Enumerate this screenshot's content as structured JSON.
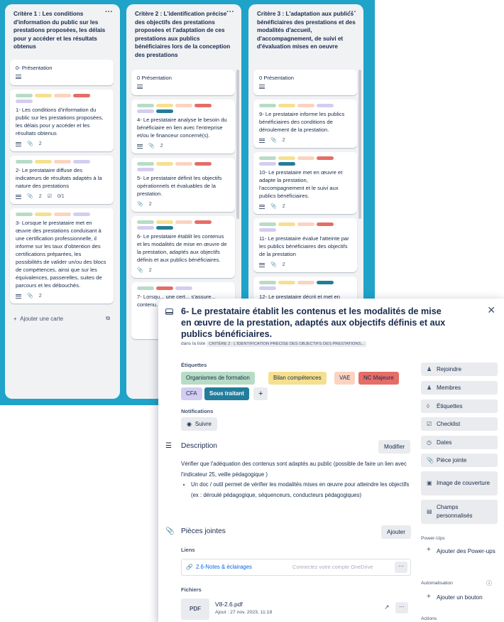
{
  "colors": {
    "board_bg": "#1fa3c8",
    "label_green": "#b7dcc6",
    "label_yellow": "#f5e08f",
    "label_orange": "#fbd3c0",
    "label_red": "#e56d67",
    "label_purple": "#d3cdf1",
    "label_teal": "#227d9b"
  },
  "columns": [
    {
      "title": "Critère 1 : Les conditions d'information du public sur les prestations proposées, les délais pour y accéder et les résultats obtenus",
      "cards": [
        {
          "text": "0- Présentation"
        },
        {
          "text": "1- Les conditions d'information du public sur les prestations proposées, les délais pour y accéder et les résultats obtenus",
          "attach": "2"
        },
        {
          "text": "2- Le prestataire diffuse des indicateurs de résultats adaptés à la nature des prestations",
          "attach": "2",
          "check": "0/1"
        },
        {
          "text": "3- Lorsque le prestataire met en œuvre des prestations conduisant à une certification professionnelle, il informe sur les taux d'obtention des certifications préparées, les possibilités de valider un/ou des blocs de compétences, ainsi que sur les équivalences, passerelles, suites de parcours et les débouchés.",
          "attach": "2"
        }
      ],
      "add": "Ajouter une carte"
    },
    {
      "title": "Critère 2 : L'identification précise des objectifs des prestations proposées et l'adaptation de ces prestations aux publics bénéficiaires lors de la conception des prestations",
      "cards": [
        {
          "text": "0  Présentation"
        },
        {
          "text": "4- Le prestataire analyse le besoin du bénéficiaire en lien avec l'entreprise et/ou le financeur concerné(s).",
          "attach": "2"
        },
        {
          "text": "5- Le prestataire définit les objectifs opérationnels et évaluables de la prestation.",
          "attach": "2"
        },
        {
          "text": "6- Le prestataire établit les contenus et les modalités de mise en œuvre de la prestation, adaptés aux objectifs définis et aux publics bénéficiaires.",
          "attach": "2"
        },
        {
          "text": "7- Lorsqu... une cert... s'assure... contenu... exigence..."
        }
      ],
      "add": "Ajou..."
    },
    {
      "title": "Critère 3 : L'adaptation aux publics bénéficiaires des prestations et des modalités d'accueil, d'accompagnement, de suivi et d'évaluation mises en oeuvre",
      "cards": [
        {
          "text": "0  Présentation"
        },
        {
          "text": "9- Le prestataire informe les publics bénéficiaires des conditions de déroulement de la prestation.",
          "attach": "2"
        },
        {
          "text": "10- Le prestataire met en œuvre et adapte la prestation, l'accompagnement et le suivi aux publics bénéficiaires.",
          "attach": "2"
        },
        {
          "text": "11- Le prestataire évalue l'atteinte par les publics bénéficiaires des objectifs de la prestation",
          "attach": "2"
        },
        {
          "text": "12- Le prestataire décrit et met en œuvre les mesures pour favoriser..."
        }
      ]
    }
  ],
  "modal": {
    "title": "6- Le prestataire établit les contenus et les modalités de mise en œuvre de la prestation, adaptés aux objectifs définis et aux publics bénéficiaires.",
    "list_prefix": "dans la liste",
    "list_name": "CRITÈRE 2 : L'IDENTIFICATION PRÉCISE DES OBJECTIFS DES PRESTATIONS...",
    "labels_heading": "Étiquettes",
    "labels": [
      "Organismes de formation",
      "Bilan compétences",
      "VAE",
      "NC Majeure",
      "CFA",
      "Sous traitant"
    ],
    "add_label": "+",
    "notifications_heading": "Notifications",
    "follow": "Suivre",
    "description_heading": "Description",
    "edit": "Modifier",
    "description_text": "Vérifier que   l'adéquation des contenus sont adaptés au public (possible de faire un lien avec l'indicateur 25, veille pédagogique )",
    "description_bullet": "Un doc / outil permet de vérifier les modalités mises en œuvre  pour atteindre les objectifs (ex : déroulé pédagogique, séquenceurs, conducteurs pédagogiques)",
    "attachments_heading": "Pièces jointes",
    "add_attachment": "Ajouter",
    "links_heading": "Liens",
    "link_text": "2.6-Notes & éclairages",
    "onedrive": "Connectez votre compte OneDrive",
    "files_heading": "Fichiers",
    "file_thumb": "PDF",
    "file_name": "V8-2.6.pdf",
    "file_meta": "Ajout : 27 nov. 2023, 11:18",
    "side": {
      "join": "Rejoindre",
      "members": "Membres",
      "labels": "Étiquettes",
      "checklist": "Checklist",
      "dates": "Dates",
      "attachment": "Pièce jointe",
      "cover": "Image de couverture",
      "custom_fields": "Champs personnalisés",
      "powerups_heading": "Power-Ups",
      "add_powerups": "Ajouter des Power-ups",
      "automation_heading": "Automatisation",
      "add_button": "Ajouter un bouton",
      "actions_heading": "Actions"
    }
  }
}
